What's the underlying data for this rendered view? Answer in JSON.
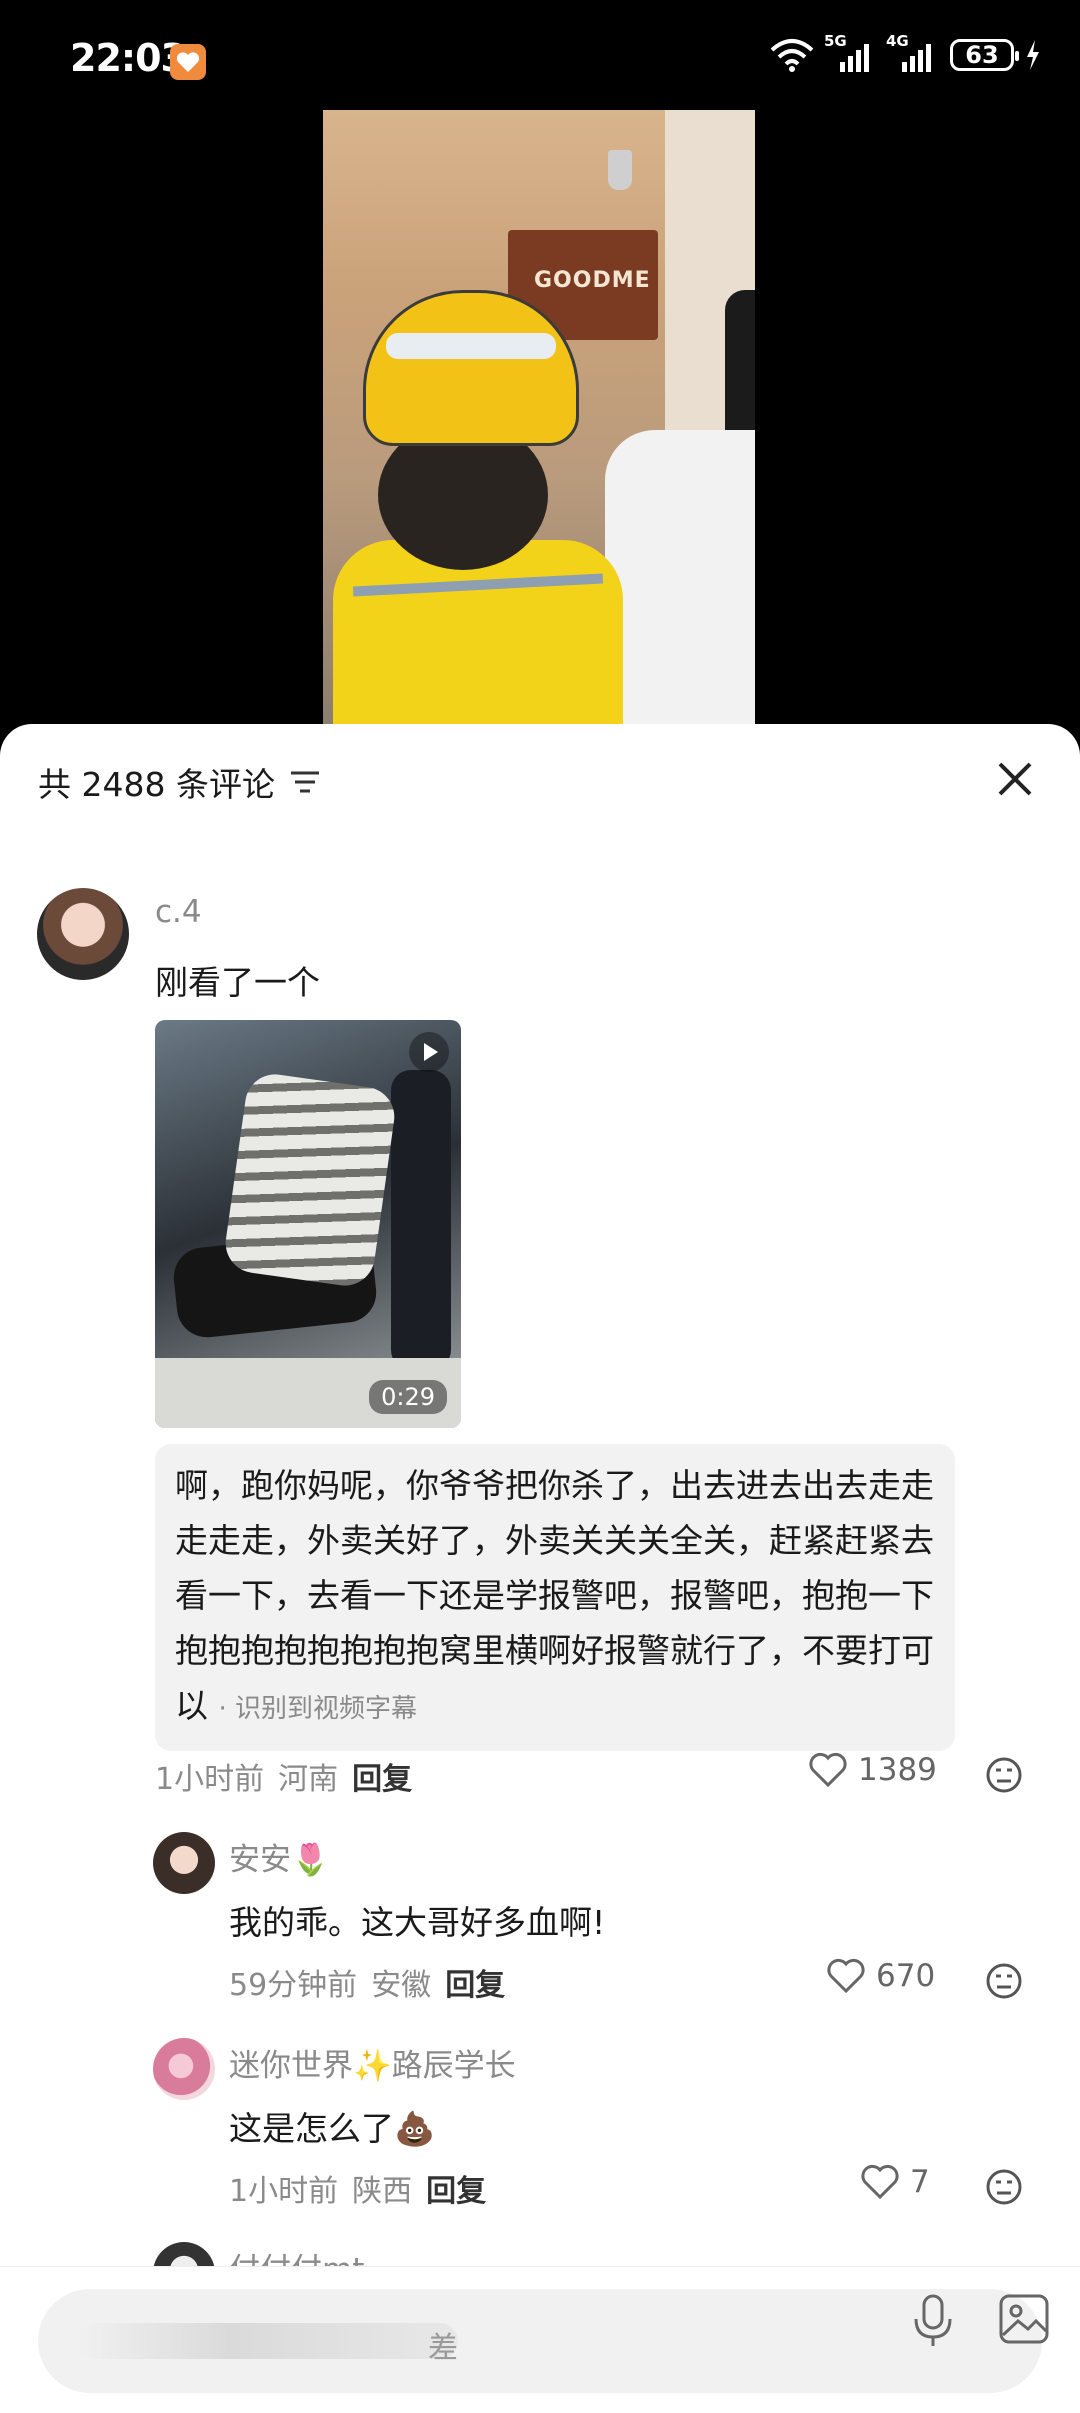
{
  "status_bar": {
    "time": "22:03",
    "net1": "5G",
    "net2": "4G",
    "battery": "63"
  },
  "video": {
    "sign_text": "GOODME"
  },
  "comments_panel": {
    "title": "共 2488 条评论",
    "comments": [
      {
        "username": "c.4",
        "text": "刚看了一个",
        "video_duration": "0:29",
        "subtitle_text": "啊，跑你妈呢，你爷爷把你杀了，出去进去出去走走走走走，外卖关好了，外卖关关关全关，赶紧赶紧去看一下，去看一下还是学报警吧，报警吧，抱抱一下抱抱抱抱抱抱抱抱窝里横啊好报警就行了，不要打可以",
        "subtitle_source": "· 识别到视频字幕",
        "time": "1小时前",
        "location": "河南",
        "reply_label": "回复",
        "likes": "1389"
      },
      {
        "username": "安安🌷",
        "text": "我的乖。这大哥好多血啊!",
        "time": "59分钟前",
        "location": "安徽",
        "reply_label": "回复",
        "likes": "670"
      },
      {
        "username": "迷你世界✨路辰学长",
        "text": "这是怎么了💩",
        "time": "1小时前",
        "location": "陕西",
        "reply_label": "回复",
        "likes": "7"
      },
      {
        "username": "付付付mt"
      }
    ]
  },
  "input_bar": {
    "placeholder_tail": "差"
  }
}
